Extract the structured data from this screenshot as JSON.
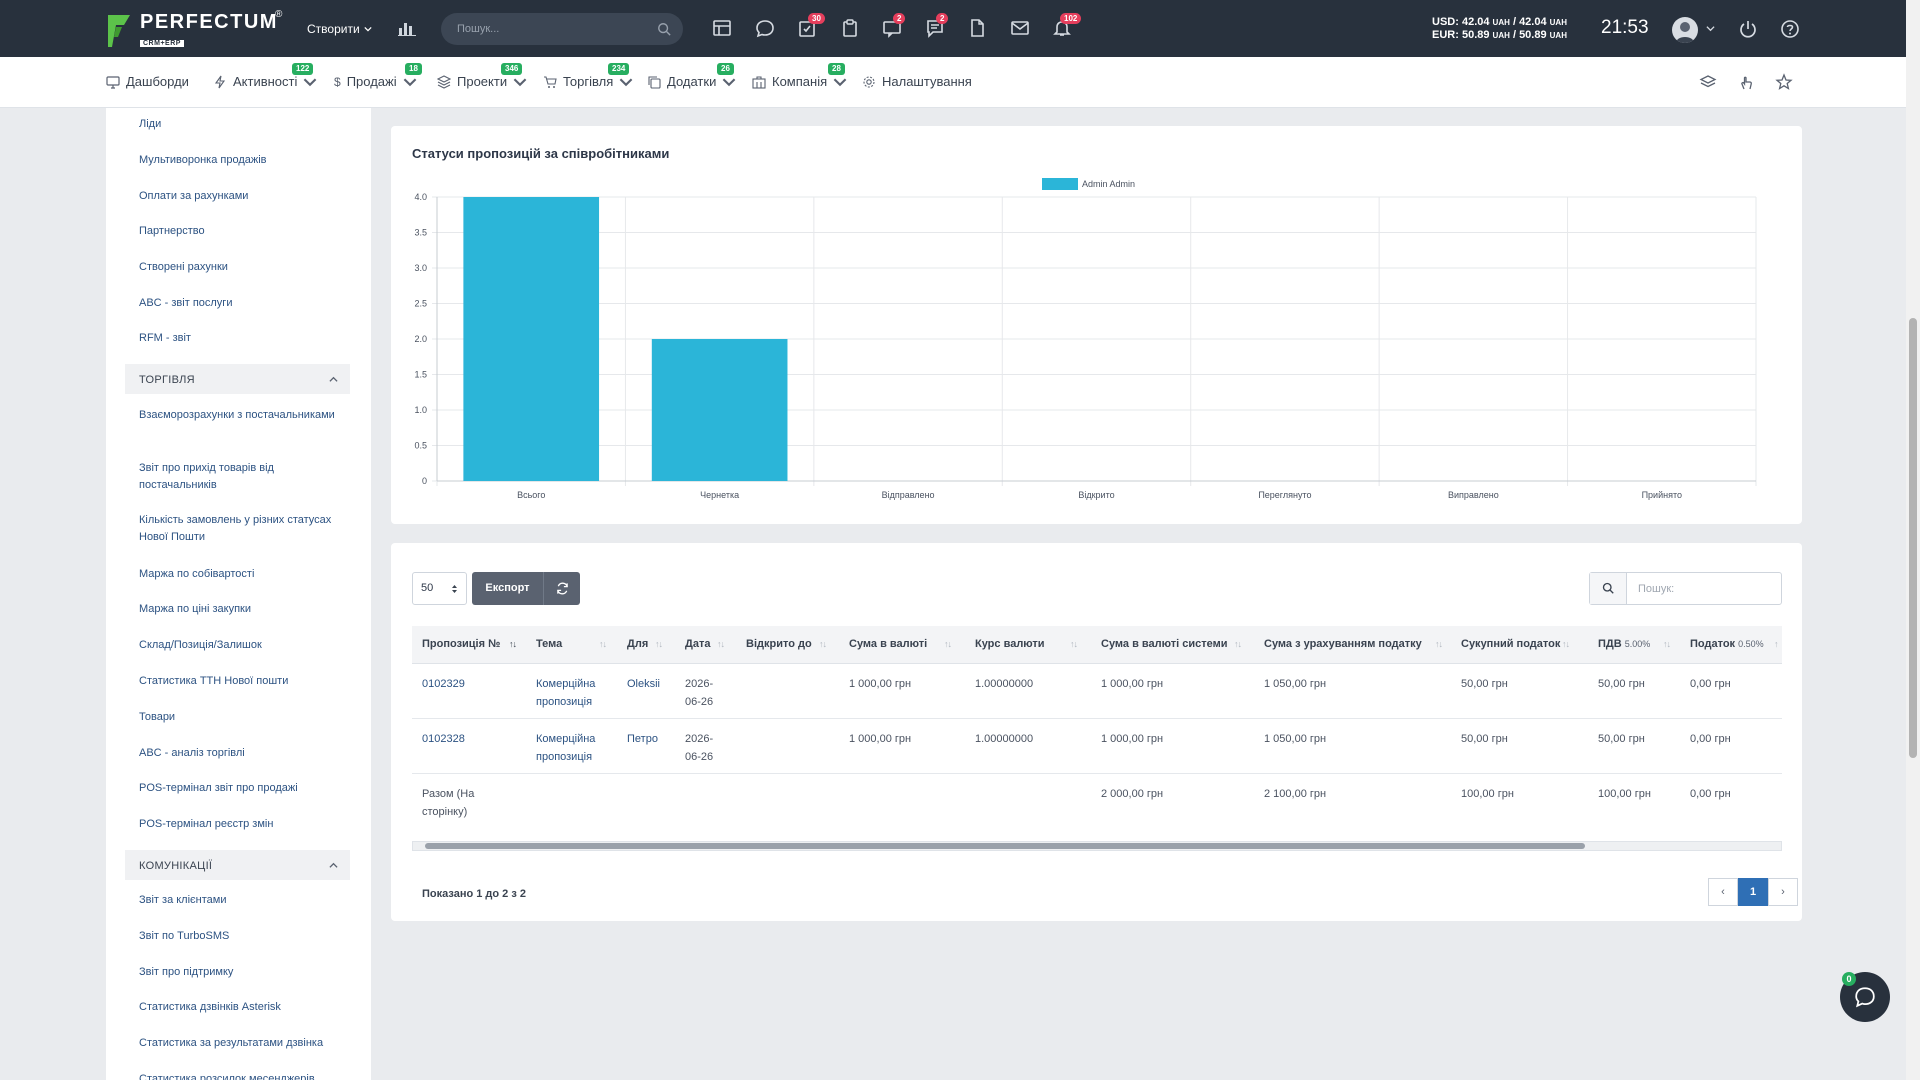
{
  "topbar": {
    "logo_name": "PERFECTUM",
    "logo_sub": "CRM+ERP",
    "logo_reg": "®",
    "create_label": "Створити",
    "search_placeholder": "Пошук...",
    "badges": {
      "tasks": "30",
      "clipboard_chat": "2",
      "messages": "2",
      "alerts": "102"
    },
    "rates": {
      "usd_label": "USD: ",
      "usd_a": "42.04",
      "usd_b": "42.04",
      "eur_label": "EUR: ",
      "eur_a": "50.89",
      "eur_b": "50.89",
      "currency": "UAH"
    },
    "time": "21:53"
  },
  "nav": {
    "items": [
      {
        "label": "Дашборди",
        "badge": ""
      },
      {
        "label": "Активності",
        "badge": "122"
      },
      {
        "label": "Продажі",
        "badge": "18"
      },
      {
        "label": "Проекти",
        "badge": "346"
      },
      {
        "label": "Торгівля",
        "badge": "234"
      },
      {
        "label": "Додатки",
        "badge": "26"
      },
      {
        "label": "Компанія",
        "badge": "28"
      },
      {
        "label": "Налаштування",
        "badge": ""
      }
    ]
  },
  "sidebar": {
    "sales_links": [
      "Ліди",
      "Мультиворонка продажів",
      "Оплати за рахунками",
      "Партнерство",
      "Створені рахунки",
      "ABC - звіт послуги",
      "RFM - звіт"
    ],
    "trade_header": "ТОРГІВЛЯ",
    "trade_links": [
      "Взаєморозрахунки з постачальниками",
      "Звіт про прихід товарів від постачальників",
      "Кількість замовлень у різних статусах Нової Пошти",
      "Маржа по собівартості",
      "Маржа по ціні закупки",
      "Склад/Позиція/Залишок",
      "Статистика ТТН Нової пошти",
      "Товари",
      "ABC - аналіз торгівлі",
      "POS-термінал звіт про продажі",
      "POS-термінал реєстр змін"
    ],
    "comm_header": "КОМУНІКАЦІЇ",
    "comm_links": [
      "Звіт за клієнтами",
      "Звіт по TurboSMS",
      "Звіт про підтримку",
      "Статистика дзвінків Asterisk",
      "Статистика за результатами дзвінка",
      "Статистика розсилок месенджерів"
    ]
  },
  "chart_data": {
    "type": "bar",
    "title": "Статуси пропозицій за співробітниками",
    "categories": [
      "Всього",
      "Чернетка",
      "Відправлено",
      "Відкрито",
      "Переглянуто",
      "Виправлено",
      "Прийнято"
    ],
    "series": [
      {
        "name": "Admin Admin",
        "values": [
          4,
          2,
          0,
          0,
          0,
          0,
          0
        ],
        "color": "#2bb5d8"
      }
    ],
    "ylim": [
      0,
      4
    ],
    "yticks": [
      "4.0",
      "3.5",
      "3.0",
      "2.5",
      "2.0",
      "1.5",
      "1.0",
      "0.5",
      "0"
    ],
    "grid": true,
    "legend": "top"
  },
  "table": {
    "page_size": "50",
    "export_label": "Експорт",
    "search_placeholder": "Пошук:",
    "columns": [
      {
        "label": "Пропозиція №",
        "sub": ""
      },
      {
        "label": "Тема",
        "sub": ""
      },
      {
        "label": "Для",
        "sub": ""
      },
      {
        "label": "Дата",
        "sub": ""
      },
      {
        "label": "Відкрито до",
        "sub": ""
      },
      {
        "label": "Сума в валюті",
        "sub": ""
      },
      {
        "label": "Курс валюти",
        "sub": ""
      },
      {
        "label": "Сума в валюті системи",
        "sub": ""
      },
      {
        "label": "Сума з урахуванням податку",
        "sub": ""
      },
      {
        "label": "Сукупний податок",
        "sub": ""
      },
      {
        "label": "ПДВ ",
        "sub": "5.00%"
      },
      {
        "label": "Податок ",
        "sub": "0.50%"
      }
    ],
    "rows": [
      {
        "num": "0102329",
        "theme_1": "Комерційна",
        "theme_2": "пропозиція",
        "for": "Oleksii",
        "date_1": "2026-",
        "date_2": "06-26",
        "open_until": "",
        "sum_cur": "1 000,00 грн",
        "rate": "1.00000000",
        "sum_sys": "1 000,00 грн",
        "sum_tax": "1 050,00 грн",
        "tax_total": "50,00 грн",
        "vat": "50,00 грн",
        "tax": "0,00 грн"
      },
      {
        "num": "0102328",
        "theme_1": "Комерційна",
        "theme_2": "пропозиція",
        "for": "Петро",
        "date_1": "2026-",
        "date_2": "06-26",
        "open_until": "",
        "sum_cur": "1 000,00 грн",
        "rate": "1.00000000",
        "sum_sys": "1 000,00 грн",
        "sum_tax": "1 050,00 грн",
        "tax_total": "50,00 грн",
        "vat": "50,00 грн",
        "tax": "0,00 грн"
      }
    ],
    "totals": {
      "label_1": "Разом (На",
      "label_2": "сторінку)",
      "sum_sys": "2 000,00 грн",
      "sum_tax": "2 100,00 грн",
      "tax_total": "100,00 грн",
      "vat": "100,00 грн",
      "tax": "0,00 грн"
    },
    "showing": "Показано 1 до 2 з 2",
    "page_prev": "‹",
    "page_current": "1",
    "page_next": "›"
  },
  "chat_badge": "0"
}
